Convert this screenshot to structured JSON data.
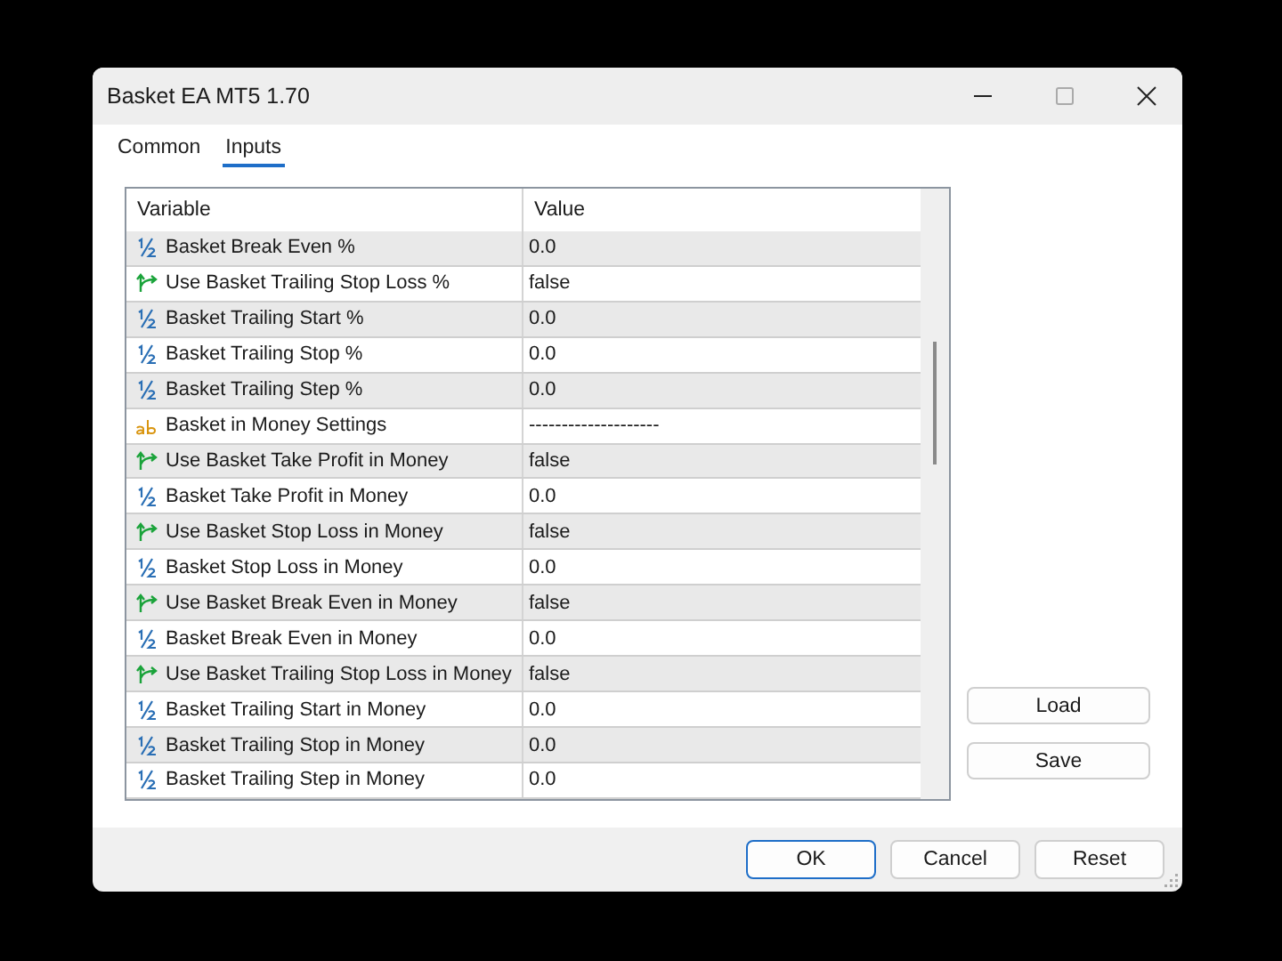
{
  "window": {
    "title": "Basket EA MT5 1.70"
  },
  "tabs": [
    {
      "label": "Common",
      "selected": false
    },
    {
      "label": "Inputs",
      "selected": true
    }
  ],
  "table": {
    "columns": [
      "Variable",
      "Value"
    ],
    "rows": [
      {
        "kind": "number",
        "variable": "Basket Break Even %",
        "value": "0.0"
      },
      {
        "kind": "bool",
        "variable": "Use Basket Trailing Stop Loss %",
        "value": "false"
      },
      {
        "kind": "number",
        "variable": "Basket Trailing Start %",
        "value": "0.0"
      },
      {
        "kind": "number",
        "variable": "Basket Trailing Stop %",
        "value": "0.0"
      },
      {
        "kind": "number",
        "variable": "Basket Trailing Step %",
        "value": "0.0"
      },
      {
        "kind": "string",
        "variable": "Basket in Money Settings",
        "value": "--------------------"
      },
      {
        "kind": "bool",
        "variable": "Use Basket Take Profit in Money",
        "value": "false"
      },
      {
        "kind": "number",
        "variable": "Basket Take Profit in Money",
        "value": "0.0"
      },
      {
        "kind": "bool",
        "variable": "Use Basket Stop Loss in Money",
        "value": "false"
      },
      {
        "kind": "number",
        "variable": "Basket Stop Loss in Money",
        "value": "0.0"
      },
      {
        "kind": "bool",
        "variable": "Use Basket Break Even in Money",
        "value": "false"
      },
      {
        "kind": "number",
        "variable": "Basket Break Even in Money",
        "value": "0.0"
      },
      {
        "kind": "bool",
        "variable": "Use Basket Trailing Stop Loss in Money",
        "value": "false"
      },
      {
        "kind": "number",
        "variable": "Basket Trailing Start in Money",
        "value": "0.0"
      },
      {
        "kind": "number",
        "variable": "Basket Trailing Stop in Money",
        "value": "0.0"
      },
      {
        "kind": "number",
        "variable": "Basket Trailing Step in Money",
        "value": "0.0"
      }
    ]
  },
  "side_buttons": [
    "Load",
    "Save"
  ],
  "buttons": [
    {
      "label": "OK",
      "default": true
    },
    {
      "label": "Cancel",
      "default": false
    },
    {
      "label": "Reset",
      "default": false
    }
  ]
}
